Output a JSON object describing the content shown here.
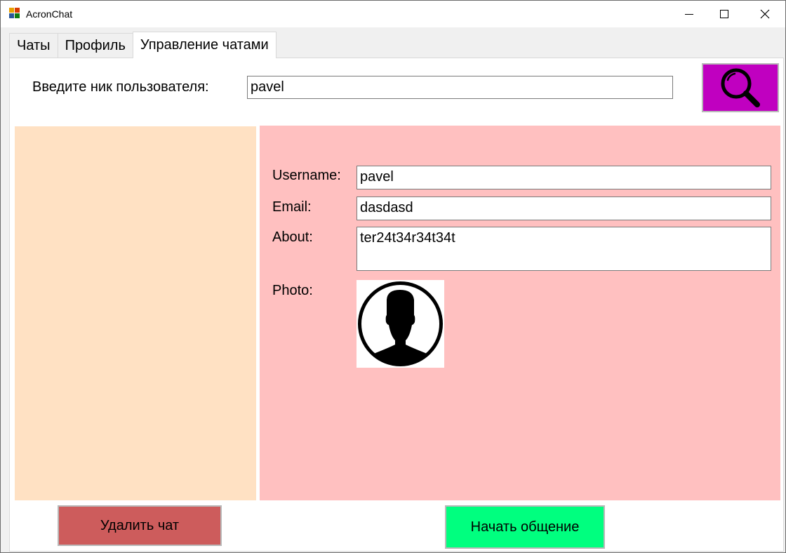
{
  "window": {
    "title": "AcronChat"
  },
  "tabs": [
    {
      "label": "Чаты",
      "active": false
    },
    {
      "label": "Профиль",
      "active": false
    },
    {
      "label": "Управление чатами",
      "active": true
    }
  ],
  "search": {
    "label": "Введите ник пользователя:",
    "value": "pavel",
    "button_icon": "search-icon",
    "button_color": "#c000c0"
  },
  "profile": {
    "username_label": "Username:",
    "username_value": "pavel",
    "email_label": "Email:",
    "email_value": "dasdasd",
    "about_label": "About:",
    "about_value": "ter24t34r34t34t",
    "photo_label": "Photo:",
    "photo_icon": "user-avatar-icon"
  },
  "actions": {
    "delete_chat": "Удалить чат",
    "start_chat": "Начать общение"
  },
  "colors": {
    "chat_list_bg": "#ffe1c3",
    "profile_bg": "#ffc0c0",
    "delete_btn": "#cd5c5c",
    "start_btn": "#00ff7f"
  }
}
